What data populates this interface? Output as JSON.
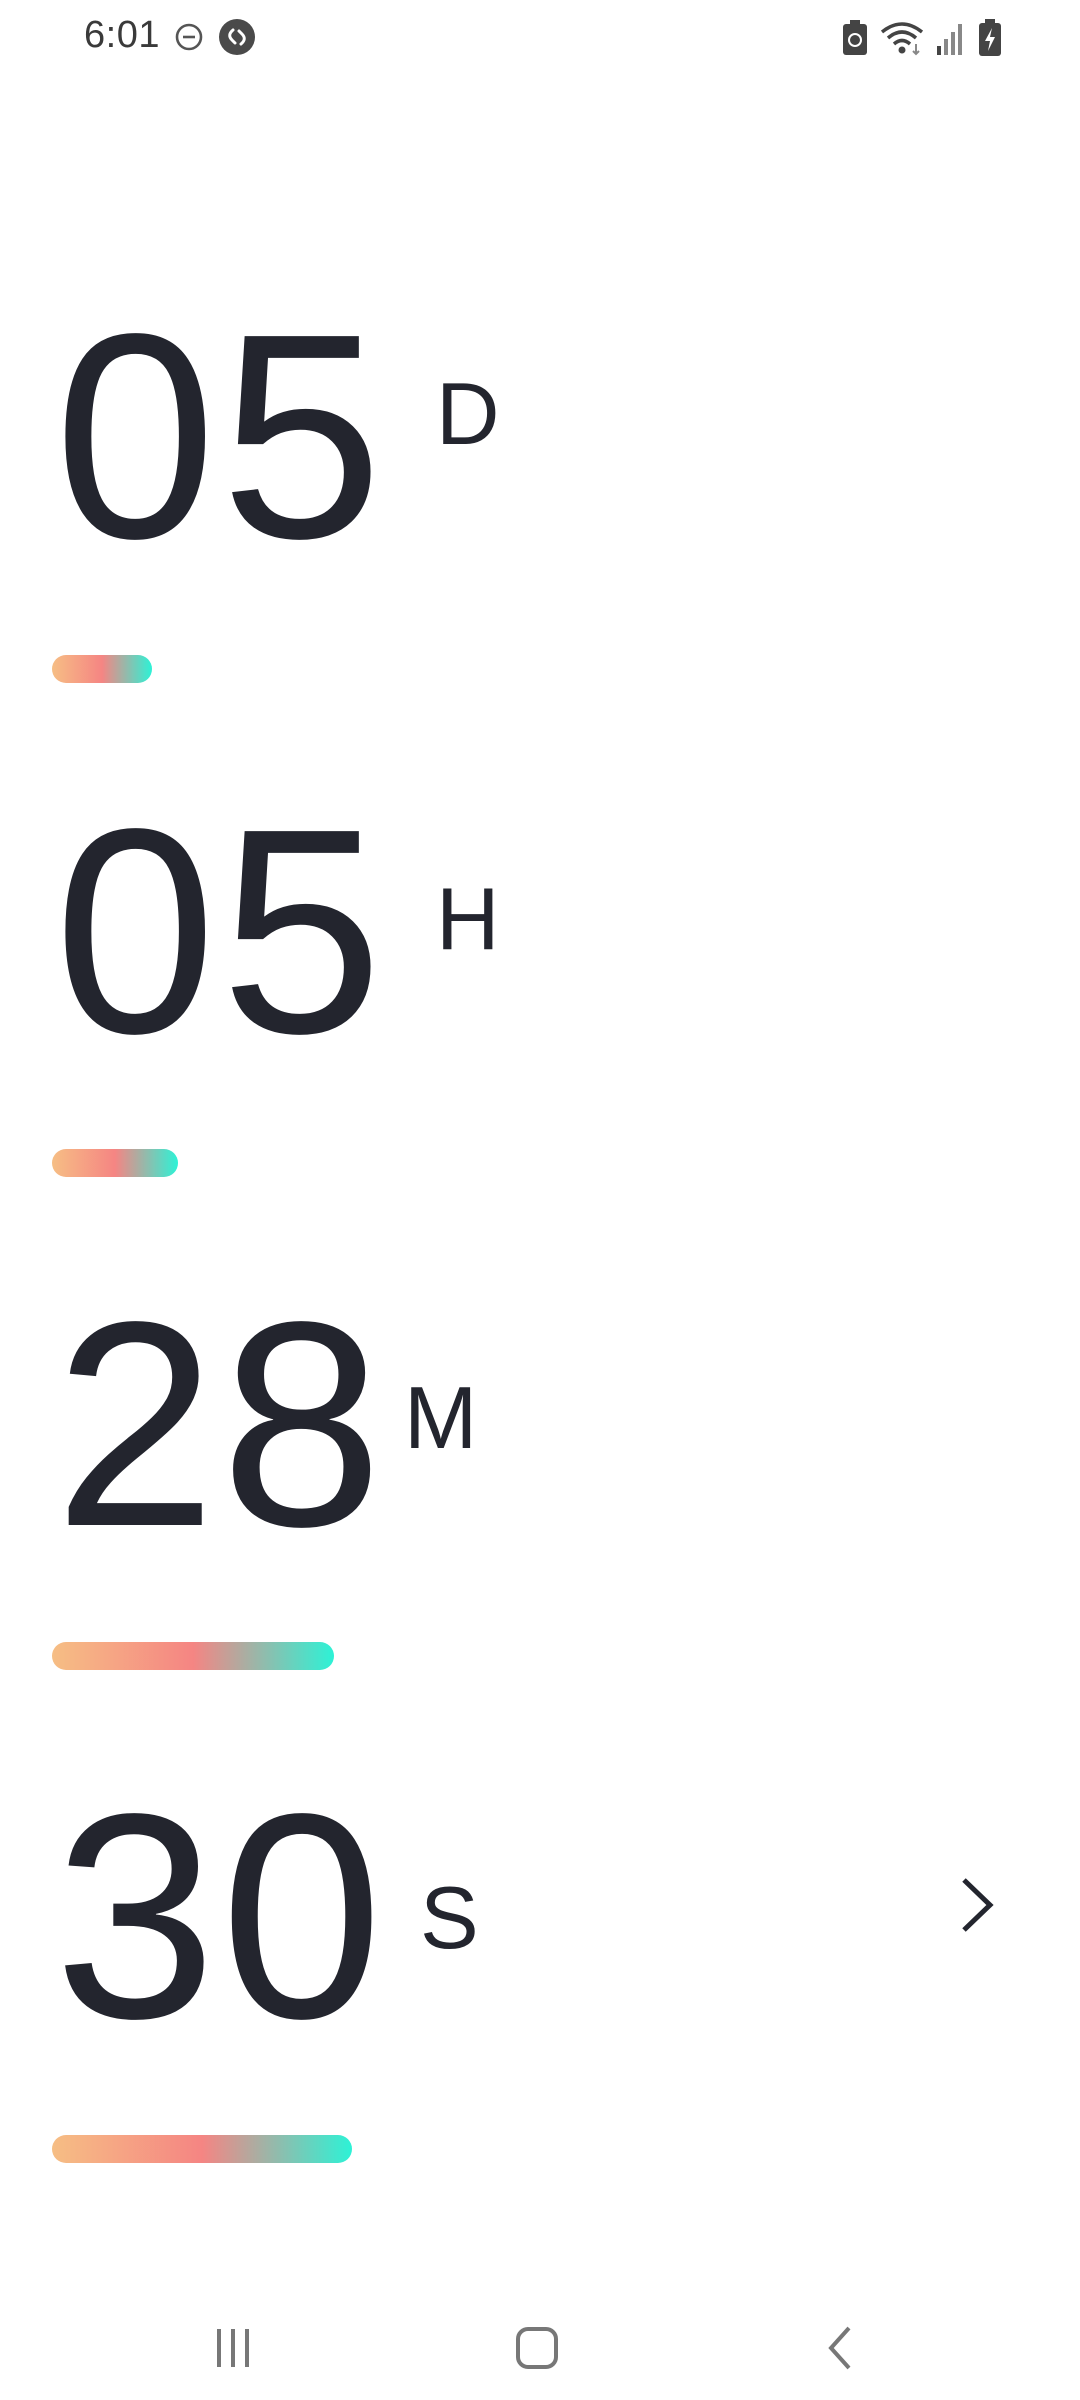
{
  "status_bar": {
    "time": "6:01",
    "icons": [
      "do-not-disturb-icon",
      "shazam-icon",
      "battery-saver-icon",
      "wifi-icon",
      "signal-icon",
      "battery-charging-icon"
    ]
  },
  "countdown": {
    "days": {
      "value": "05",
      "label": "D",
      "progress": 0.167
    },
    "hours": {
      "value": "05",
      "label": "H",
      "progress": 0.21
    },
    "minutes": {
      "value": "28",
      "label": "M",
      "progress": 0.47
    },
    "seconds": {
      "value": "30",
      "label": "S",
      "progress": 0.5
    }
  },
  "colors": {
    "text": "#23252e",
    "gradient_start": "#f6be84",
    "gradient_mid": "#f58583",
    "gradient_end": "#2df2d6"
  },
  "navigation": {
    "next": "chevron-right-icon",
    "buttons": [
      "recent-apps-icon",
      "home-icon",
      "back-icon"
    ]
  }
}
